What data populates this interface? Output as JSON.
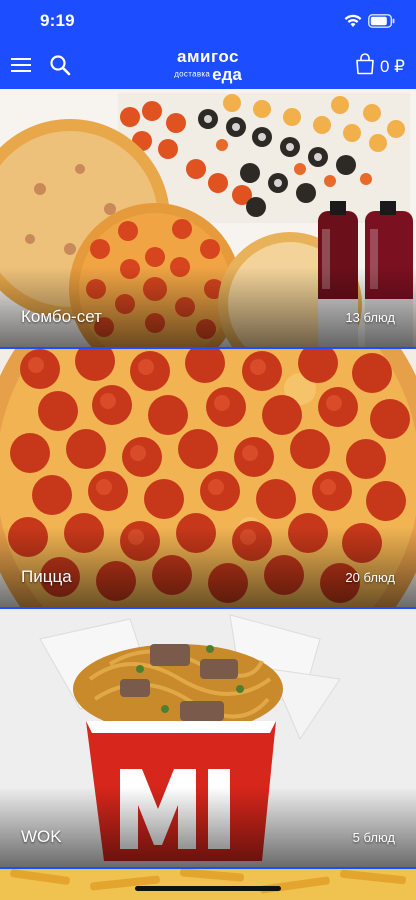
{
  "status_bar": {
    "time": "9:19"
  },
  "header": {
    "logo_line1": "амигос",
    "logo_line2": "доставка",
    "logo_line3": "еда",
    "cart_count": "0 ₽",
    "accent_color": "#1c4dff"
  },
  "categories": [
    {
      "name": "Комбо-сет",
      "count": "13 блюд"
    },
    {
      "name": "Пицца",
      "count": "20 блюд"
    },
    {
      "name": "WOK",
      "count": "5 блюд"
    }
  ],
  "icons": [
    "wifi-icon",
    "battery-icon",
    "menu-icon",
    "search-icon",
    "shopping-bag-icon"
  ]
}
